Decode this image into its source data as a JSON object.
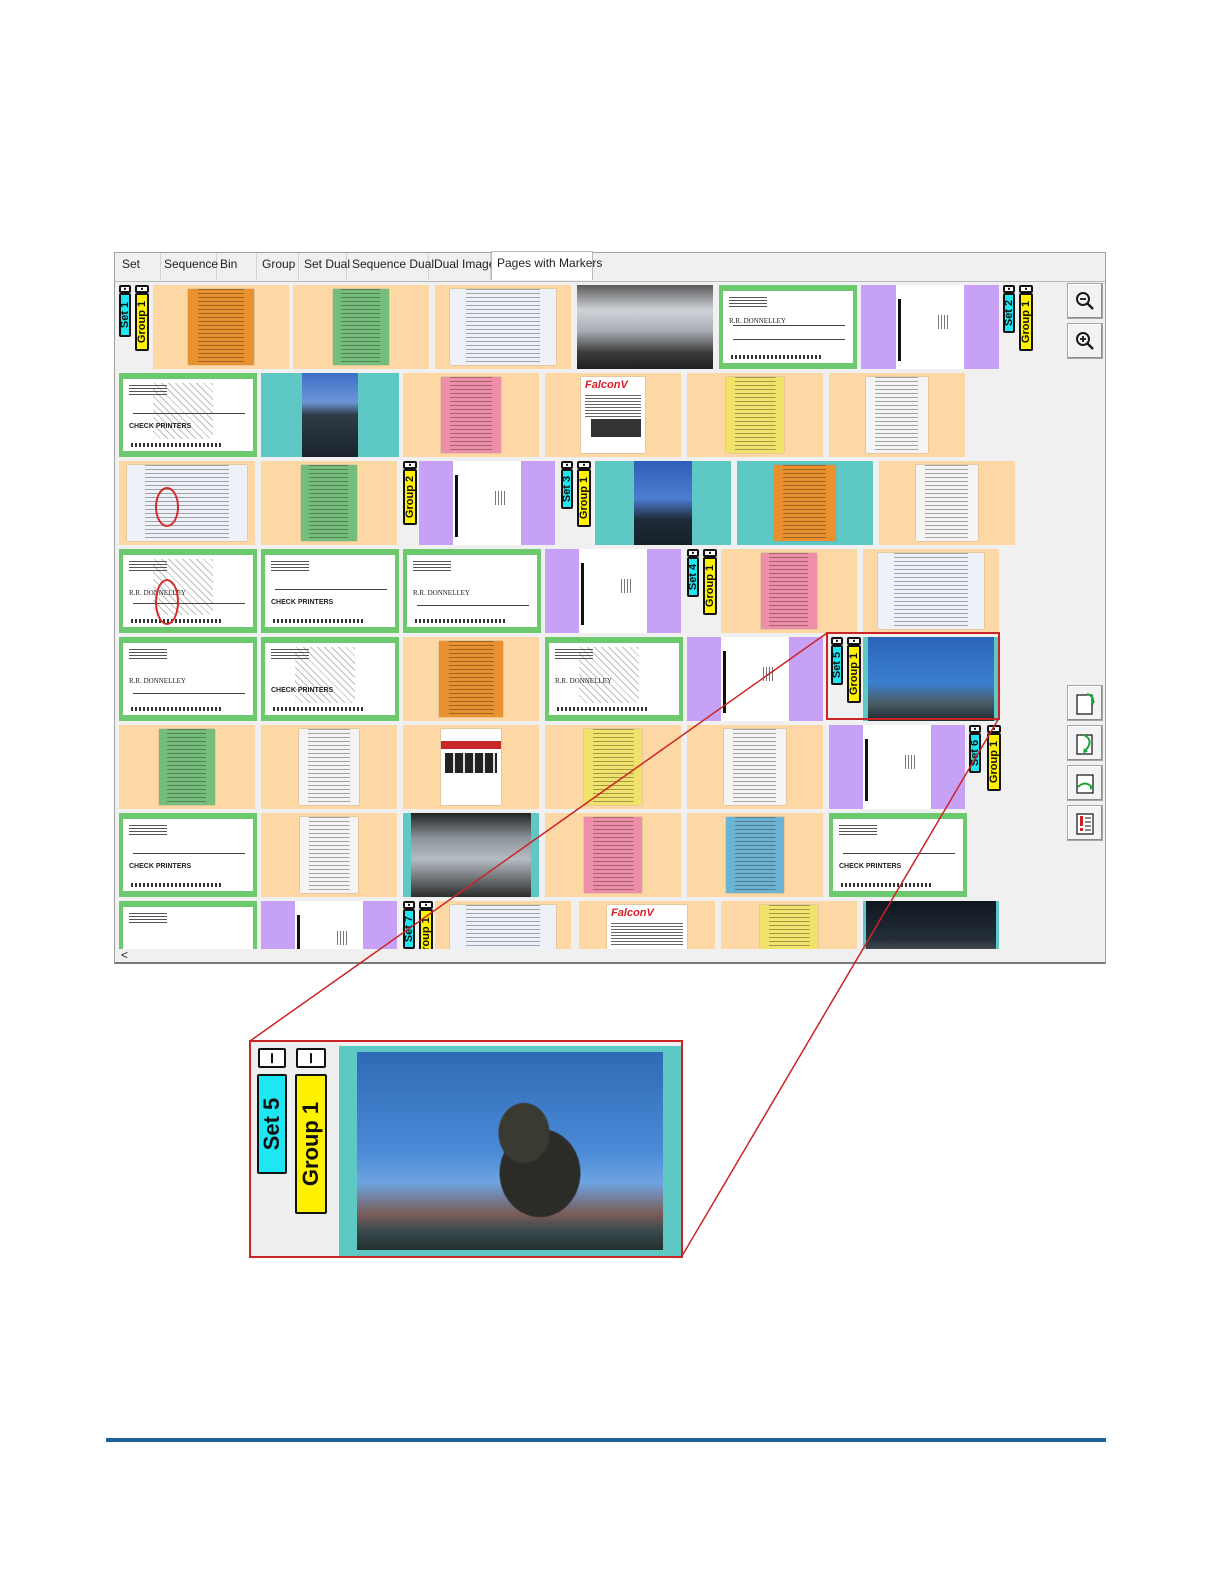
{
  "tabs": [
    {
      "label": "Set",
      "active": false
    },
    {
      "label": "Sequence",
      "active": false
    },
    {
      "label": "Bin",
      "active": false
    },
    {
      "label": "Group",
      "active": false
    },
    {
      "label": "Set Dual",
      "active": false
    },
    {
      "label": "Sequence Dual",
      "active": false
    },
    {
      "label": "Dual Image",
      "active": false
    },
    {
      "label": "Pages with Markers",
      "active": true
    }
  ],
  "markers": {
    "row1_set": "Set 1",
    "row1_group": "Group 1",
    "row1_set2": "Set 2",
    "row1_group2": "Group 1",
    "row3_group": "Group 2",
    "row3_set": "Set 3",
    "row3_group2": "Group 1",
    "row4_set": "Set 4",
    "row4_group": "Group 1",
    "row5_set": "Set 5",
    "row5_group": "Group 1",
    "row6_set": "Set 6",
    "row6_group": "Group 1",
    "row8_set": "Set 7",
    "row8_group": "roup 1"
  },
  "zoom": {
    "set_label": "Set 5",
    "group_label": "Group 1"
  },
  "documents": {
    "falcon_brand": "FalconV",
    "check_logo": "CHECK PRINTERS",
    "bank_name": "R.R. DONNELLEY"
  },
  "tools": [
    "zoom-out-icon",
    "zoom-in-icon",
    "rotate-right-icon",
    "rotate-left-icon",
    "flip-icon",
    "marker-settings-icon"
  ],
  "scroll_arrow": "<",
  "colors": {
    "set_marker": "#1ee6f2",
    "group_marker": "#fff200",
    "highlight": "#cc2424",
    "footer_rule": "#1f5f93"
  }
}
